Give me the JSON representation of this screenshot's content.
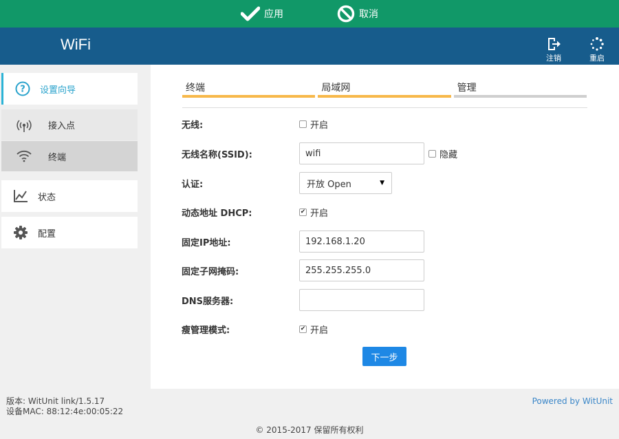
{
  "topbar": {
    "apply_label": "应用",
    "cancel_label": "取消"
  },
  "header": {
    "title": "WiFi",
    "logout_label": "注销",
    "reboot_label": "重启"
  },
  "sidebar": {
    "items": [
      {
        "label": "设置向导",
        "icon": "question-circle-icon"
      },
      {
        "label": "接入点",
        "icon": "antenna-icon"
      },
      {
        "label": "终端",
        "icon": "wifi-icon"
      },
      {
        "label": "状态",
        "icon": "chart-line-icon"
      },
      {
        "label": "配置",
        "icon": "gear-icon"
      }
    ]
  },
  "tabs": [
    {
      "label": "终端"
    },
    {
      "label": "局域网"
    },
    {
      "label": "管理"
    }
  ],
  "form": {
    "wireless": {
      "label": "无线:",
      "option": "开启",
      "checked": false
    },
    "ssid": {
      "label": "无线名称(SSID):",
      "value": "wifi",
      "hide_label": "隐藏",
      "hide_checked": false
    },
    "auth": {
      "label": "认证:",
      "selected": "开放 Open"
    },
    "dhcp": {
      "label": "动态地址 DHCP:",
      "option": "开启",
      "checked": true
    },
    "static_ip": {
      "label": "固定IP地址:",
      "value": "192.168.1.20"
    },
    "netmask": {
      "label": "固定子网掩码:",
      "value": "255.255.255.0"
    },
    "dns": {
      "label": "DNS服务器:",
      "value": ""
    },
    "thin_mode": {
      "label": "瘦管理模式:",
      "option": "开启",
      "checked": true
    },
    "next_label": "下一步"
  },
  "footer": {
    "version": "版本: WitUnit link/1.5.17",
    "mac": "设备MAC: 88:12:4e:00:05:22",
    "powered": "Powered by WitUnit",
    "copyright": "© 2015-2017  保留所有权利"
  },
  "colors": {
    "topbar": "#119868",
    "header": "#175c8c",
    "tab_active": "#f7b84a",
    "tab_inactive": "#cfcfcf",
    "primary_button": "#1e88e5",
    "sidebar_accent": "#2bb3d6"
  }
}
